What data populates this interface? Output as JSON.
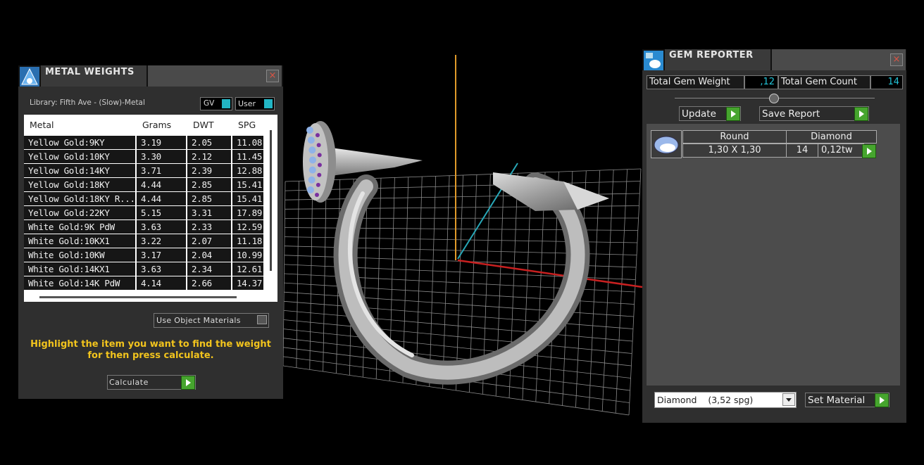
{
  "colors": {
    "accent_green": "#46a52e",
    "teal": "#22b5c4",
    "yellow_text": "#f2c41d"
  },
  "metal_panel": {
    "title": "METAL WEIGHTS",
    "close_label": "×",
    "library_label": "Library: Fifth Ave - (Slow)-Metal",
    "gv_label": "GV",
    "user_label": "User",
    "columns": [
      "Metal",
      "Grams",
      "DWT",
      "SPG"
    ],
    "rows": [
      {
        "metal": "Yellow Gold:9KY",
        "grams": "3.19",
        "dwt": "2.05",
        "spg": "11.08"
      },
      {
        "metal": "Yellow Gold:10KY",
        "grams": "3.30",
        "dwt": "2.12",
        "spg": "11.45"
      },
      {
        "metal": "Yellow Gold:14KY",
        "grams": "3.71",
        "dwt": "2.39",
        "spg": "12.88"
      },
      {
        "metal": "Yellow Gold:18KY",
        "grams": "4.44",
        "dwt": "2.85",
        "spg": "15.41"
      },
      {
        "metal": "Yellow Gold:18KY R...",
        "grams": "4.44",
        "dwt": "2.85",
        "spg": "15.41"
      },
      {
        "metal": "Yellow Gold:22KY",
        "grams": "5.15",
        "dwt": "3.31",
        "spg": "17.89"
      },
      {
        "metal": "White Gold:9K PdW",
        "grams": "3.63",
        "dwt": "2.33",
        "spg": "12.59"
      },
      {
        "metal": "White Gold:10KX1",
        "grams": "3.22",
        "dwt": "2.07",
        "spg": "11.18"
      },
      {
        "metal": "White Gold:10KW",
        "grams": "3.17",
        "dwt": "2.04",
        "spg": "10.99"
      },
      {
        "metal": "White Gold:14KX1",
        "grams": "3.63",
        "dwt": "2.34",
        "spg": "12.61"
      },
      {
        "metal": "White Gold:14K PdW",
        "grams": "4.14",
        "dwt": "2.66",
        "spg": "14.37"
      }
    ],
    "use_object_materials_label": "Use Object Materials",
    "message": "Highlight the item you want to find the weight for then press calculate.",
    "calculate_label": "Calculate"
  },
  "gem_panel": {
    "title": "GEM REPORTER",
    "close_label": "×",
    "total_weight_label": "Total Gem Weight",
    "total_weight_value": ",12",
    "total_count_label": "Total Gem Count",
    "total_count_value": "14",
    "update_label": "Update",
    "save_report_label": "Save Report",
    "gem_row": {
      "shape": "Round",
      "type": "Diamond",
      "size": "1,30 X 1,30",
      "count": "14",
      "weight": "0,12tw"
    },
    "material_select": "Diamond    (3,52 spg)",
    "set_material_label": "Set Material"
  }
}
